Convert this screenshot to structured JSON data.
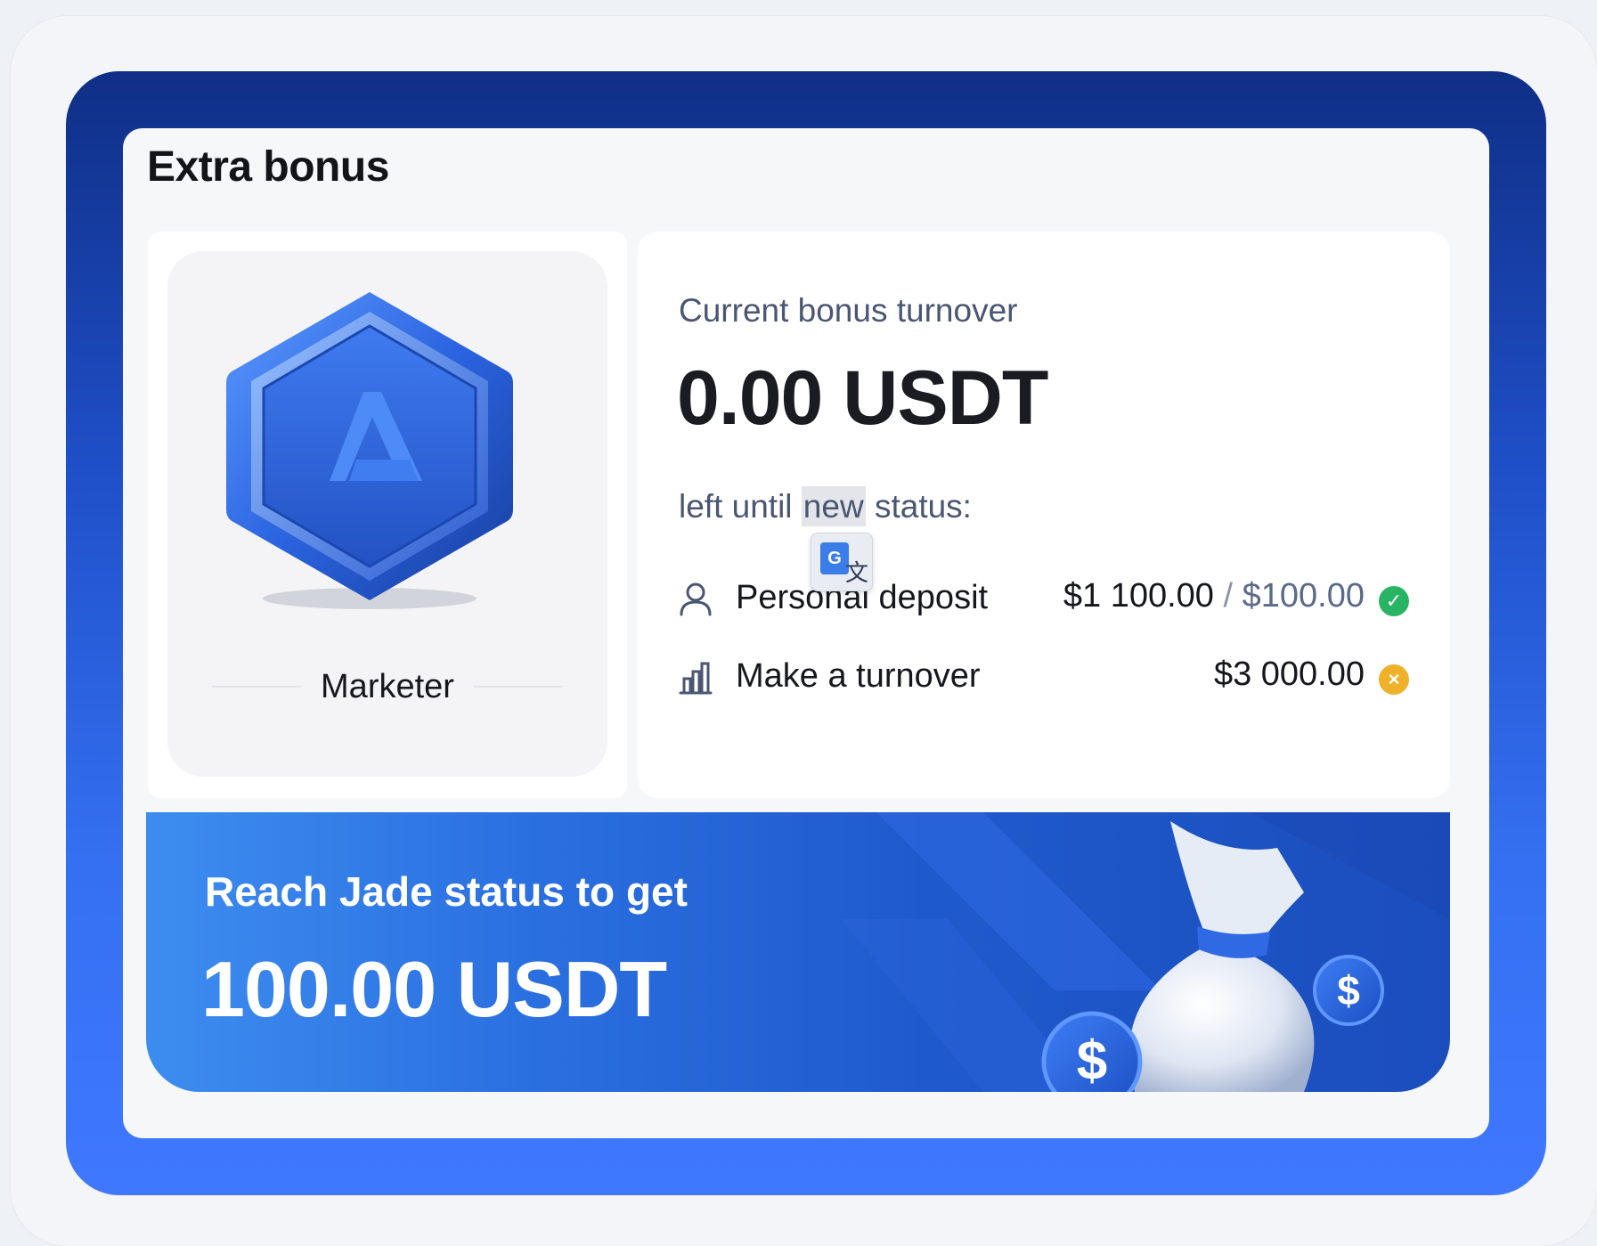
{
  "card": {
    "title": "Extra bonus"
  },
  "status_badge": {
    "icon": "hexagon-badge-icon",
    "label": "Marketer"
  },
  "turnover": {
    "subtitle": "Current bonus turnover",
    "amount": "0.00 USDT",
    "left_prefix": "left until ",
    "left_highlight": "new",
    "left_suffix": " status:"
  },
  "translate_popup": {
    "icon": "google-translate-icon",
    "letter": "G",
    "glyph": "文"
  },
  "requirements": [
    {
      "icon": "user-icon",
      "label": "Personal deposit",
      "current": "$1 100.00",
      "separator": " / ",
      "target": "$100.00",
      "status_icon": "check-icon",
      "status_color": "#28b463"
    },
    {
      "icon": "bar-chart-icon",
      "label": "Make a turnover",
      "current": "$3 000.00",
      "status_icon": "cross-icon",
      "status_color": "#f0b12a"
    }
  ],
  "promo": {
    "text": "Reach Jade status to get",
    "amount": "100.00 USDT",
    "image": "money-bag-icon"
  },
  "colors": {
    "outer_gradient_top": "#0f2f86",
    "outer_gradient_bottom": "#3f78ff",
    "promo_blue": "#2a6fe0"
  }
}
